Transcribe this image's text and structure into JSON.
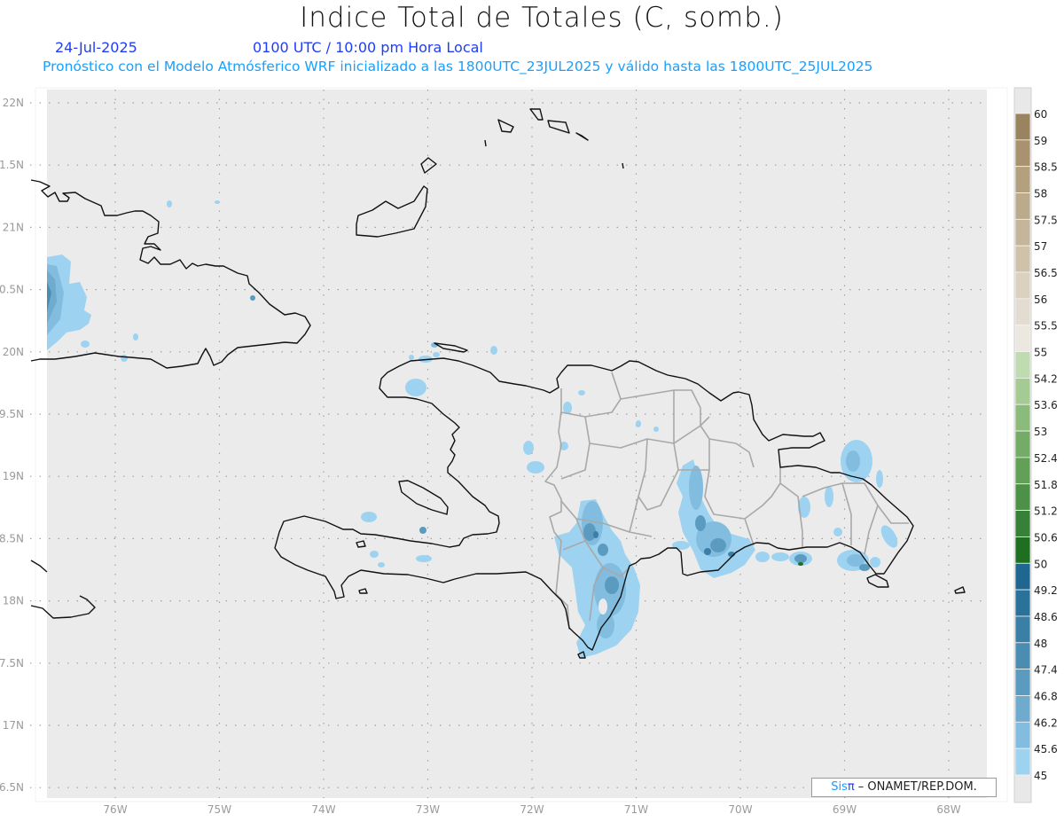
{
  "header": {
    "title": "Indice Total de Totales (C, somb.)",
    "date": "24-Jul-2025",
    "time": "0100 UTC / 10:00 pm Hora Local",
    "init": "Pronóstico con el Modelo Atmósferico WRF inicializado a las 1800UTC_23JUL2025 y válido hasta las  1800UTC_25JUL2025"
  },
  "map": {
    "lon_ticks": [
      {
        "value": -76,
        "label": "76W"
      },
      {
        "value": -75,
        "label": "75W"
      },
      {
        "value": -74,
        "label": "74W"
      },
      {
        "value": -73,
        "label": "73W"
      },
      {
        "value": -72,
        "label": "72W"
      },
      {
        "value": -71,
        "label": "71W"
      },
      {
        "value": -70,
        "label": "70W"
      },
      {
        "value": -69,
        "label": "69W"
      },
      {
        "value": -68,
        "label": "68W"
      }
    ],
    "lat_ticks": [
      {
        "value": 22,
        "label": "22N"
      },
      {
        "value": 21.5,
        "label": "1.5N"
      },
      {
        "value": 21,
        "label": "21N"
      },
      {
        "value": 20.5,
        "label": "0.5N"
      },
      {
        "value": 20,
        "label": "20N"
      },
      {
        "value": 19.5,
        "label": "9.5N"
      },
      {
        "value": 19,
        "label": "19N"
      },
      {
        "value": 18.5,
        "label": "8.5N"
      },
      {
        "value": 18,
        "label": "18N"
      },
      {
        "value": 17.5,
        "label": "7.5N"
      },
      {
        "value": 17,
        "label": "17N"
      },
      {
        "value": 16.5,
        "label": "6.5N"
      }
    ]
  },
  "colorbar": {
    "labels": [
      "60",
      "59",
      "58.5",
      "58",
      "57.5",
      "57",
      "56.5",
      "56",
      "55.5",
      "55",
      "54.2",
      "53.6",
      "53",
      "52.4",
      "51.8",
      "51.2",
      "50.6",
      "50",
      "49.2",
      "48.6",
      "48",
      "47.4",
      "46.8",
      "46.2",
      "45.6",
      "45"
    ],
    "colors": [
      "#9a8460",
      "#a89270",
      "#b3a07f",
      "#bcaa8c",
      "#c5b59a",
      "#d0c2aa",
      "#dbd1bf",
      "#e3dcd0",
      "#ece8e0",
      "#bfdcb0",
      "#a4cb94",
      "#8abb7a",
      "#74ab66",
      "#62a058",
      "#4d9048",
      "#368038",
      "#1e6f20",
      "#1f6690",
      "#2b729a",
      "#3a7fa6",
      "#4a8cb2",
      "#5b9bc0",
      "#6eabcd",
      "#82bcdf",
      "#9dd3f0"
    ]
  },
  "credit": {
    "sis": "Sis",
    "pi": "π",
    "org": " – ONAMET/REP.DOM."
  }
}
